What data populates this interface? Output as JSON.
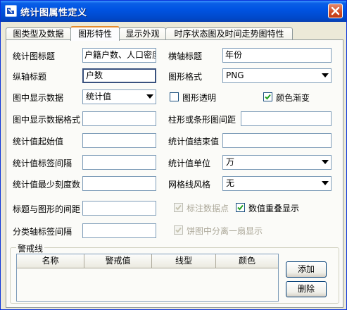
{
  "window": {
    "title": "统计图属性定义"
  },
  "tabs": [
    {
      "label": "图类型及数据"
    },
    {
      "label": "图形特性"
    },
    {
      "label": "显示外观"
    },
    {
      "label": "时序状态图及时间走势图特性"
    }
  ],
  "form": {
    "chart_title": {
      "label": "统计图标题",
      "value": "户籍户数、人口密度"
    },
    "x_axis_title": {
      "label": "横轴标题",
      "value": "年份"
    },
    "y_axis_title": {
      "label": "纵轴标题",
      "value": "户数"
    },
    "chart_format": {
      "label": "图形格式",
      "value": "PNG"
    },
    "display_data": {
      "label": "图中显示数据",
      "value": "统计值"
    },
    "transparent": {
      "label": "图形透明",
      "checked": false
    },
    "gradient": {
      "label": "颜色渐变",
      "checked": true
    },
    "data_format": {
      "label": "图中显示数据格式",
      "value": ""
    },
    "bar_spacing": {
      "label": "柱形或条形图间距",
      "value": ""
    },
    "start_value": {
      "label": "统计值起始值",
      "value": ""
    },
    "end_value": {
      "label": "统计值结束值",
      "value": ""
    },
    "label_interval": {
      "label": "统计值标签间隔",
      "value": ""
    },
    "unit": {
      "label": "统计值单位",
      "value": "万"
    },
    "min_ticks": {
      "label": "统计值最少刻度数",
      "value": ""
    },
    "grid_style": {
      "label": "网格线风格",
      "value": "无"
    },
    "title_spacing": {
      "label": "标题与图形的间距",
      "value": ""
    },
    "mark_points": {
      "label": "标注数据点",
      "checked": false,
      "disabled": true
    },
    "overlap_values": {
      "label": "数值重叠显示",
      "checked": true
    },
    "category_interval": {
      "label": "分类轴标签间隔",
      "value": ""
    },
    "pie_separate": {
      "label": "饼图中分离一扇显示",
      "checked": true,
      "disabled": true
    }
  },
  "warning": {
    "group_label": "警戒线",
    "columns": [
      "名称",
      "警戒值",
      "线型",
      "颜色"
    ],
    "rows": [],
    "add_label": "添加",
    "delete_label": "删除"
  }
}
